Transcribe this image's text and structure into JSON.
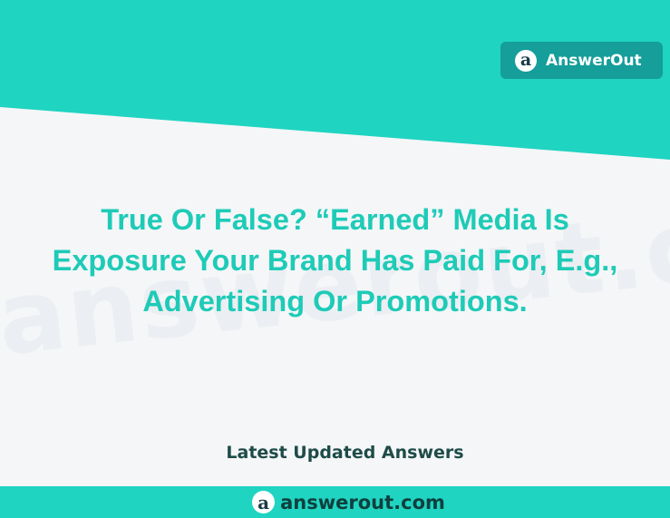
{
  "brand": {
    "name": "AnswerOut",
    "logo_letter": "a"
  },
  "watermark": {
    "text": "answerout.com"
  },
  "question": {
    "lines": [
      "True Or False? “Earned” Media Is",
      "Exposure Your Brand Has Paid For, E.g.,",
      "Advertising Or Promotions."
    ]
  },
  "latest_label": "Latest Updated Answers",
  "footer": {
    "logo_letter": "a",
    "domain": "answerout.com"
  },
  "colors": {
    "teal": "#1fd4c1",
    "badge": "#159e9a",
    "question_text": "#1ecbb7",
    "dark_text": "#1e4c48",
    "background": "#f5f6f8"
  }
}
